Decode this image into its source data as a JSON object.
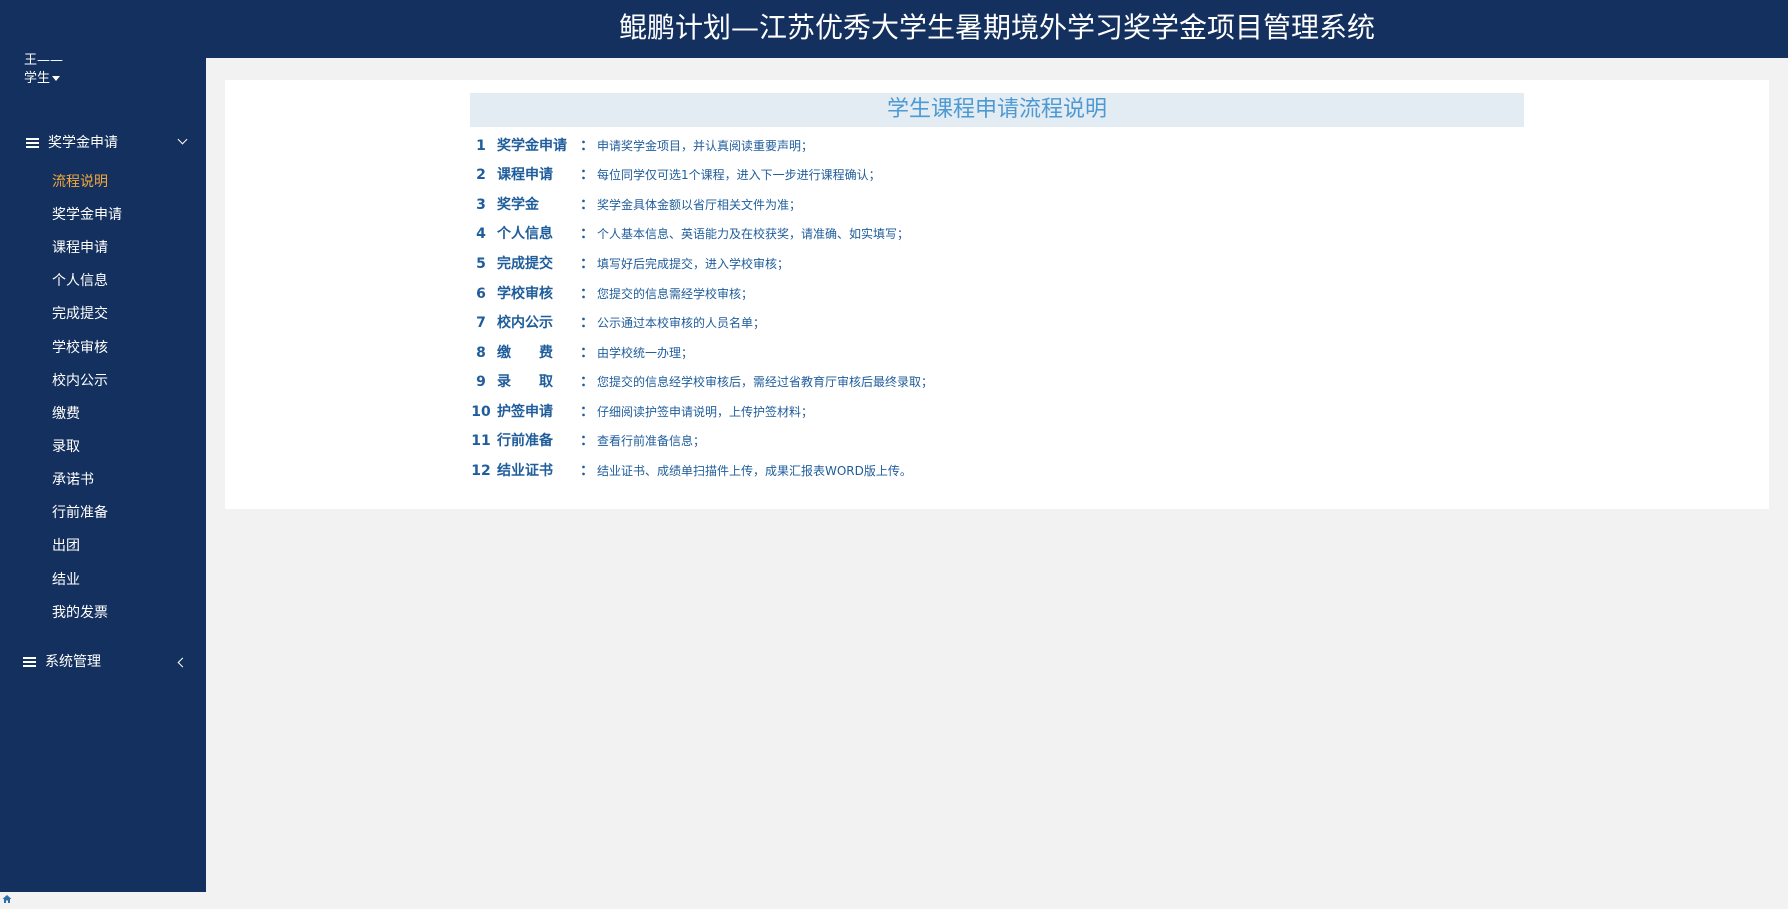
{
  "header": {
    "title": "鲲鹏计划—江苏优秀大学生暑期境外学习奖学金项目管理系统"
  },
  "user": {
    "name": "王——",
    "role": "学生"
  },
  "sidebar": {
    "groups": [
      {
        "label": "奖学金申请",
        "items": [
          {
            "label": "流程说明",
            "active": true
          },
          {
            "label": "奖学金申请"
          },
          {
            "label": "课程申请"
          },
          {
            "label": "个人信息"
          },
          {
            "label": "完成提交"
          },
          {
            "label": "学校审核"
          },
          {
            "label": "校内公示"
          },
          {
            "label": "缴费"
          },
          {
            "label": "录取"
          },
          {
            "label": "承诺书"
          },
          {
            "label": "行前准备"
          },
          {
            "label": "出团"
          },
          {
            "label": "结业"
          },
          {
            "label": "我的发票"
          }
        ]
      },
      {
        "label": "系统管理",
        "items": []
      }
    ]
  },
  "main": {
    "title": "学生课程申请流程说明",
    "colon": "：",
    "steps": [
      {
        "num": "1",
        "name": "奖学金申请",
        "desc": "申请奖学金项目，并认真阅读重要声明；"
      },
      {
        "num": "2",
        "name": "课程申请",
        "desc": "每位同学仅可选1个课程，进入下一步进行课程确认；"
      },
      {
        "num": "3",
        "name": "奖学金",
        "desc": "奖学金具体金额以省厅相关文件为准；"
      },
      {
        "num": "4",
        "name": "个人信息",
        "desc": "个人基本信息、英语能力及在校获奖，请准确、如实填写；"
      },
      {
        "num": "5",
        "name": "完成提交",
        "desc": "填写好后完成提交，进入学校审核；"
      },
      {
        "num": "6",
        "name": "学校审核",
        "desc": "您提交的信息需经学校审核；"
      },
      {
        "num": "7",
        "name": "校内公示",
        "desc": "公示通过本校审核的人员名单；"
      },
      {
        "num": "8",
        "name": "缴　　费",
        "desc": "由学校统一办理；"
      },
      {
        "num": "9",
        "name": "录　　取",
        "desc": "您提交的信息经学校审核后，需经过省教育厅审核后最终录取；"
      },
      {
        "num": "10",
        "name": "护签申请",
        "desc": "仔细阅读护签申请说明，上传护签材料；"
      },
      {
        "num": "11",
        "name": "行前准备",
        "desc": "查看行前准备信息；"
      },
      {
        "num": "12",
        "name": "结业证书",
        "desc": "结业证书、成绩单扫描件上传，成果汇报表WORD版上传。"
      }
    ]
  },
  "icons": [
    "menu-icon",
    "chevron-down-icon",
    "chevron-left-icon",
    "caret-down-icon",
    "home-icon"
  ],
  "colors": {
    "nav_bg": "#14305e",
    "active_item": "#f2a93b",
    "title_text": "#4d9ad3",
    "step_text": "#1f5d9b",
    "title_bar_bg": "#e3ebf3"
  }
}
